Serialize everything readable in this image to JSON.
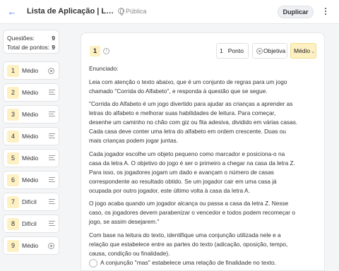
{
  "header": {
    "back_icon": "arrow-left-icon",
    "title": "Lista de Aplicação | Leitura e Interpretação",
    "visibility": "Pública",
    "duplicate_label": "Duplicar",
    "more_icon": "kebab-icon"
  },
  "sidebar": {
    "questions_label": "Questões:",
    "questions_count": "9",
    "points_label": "Total de pontos:",
    "points_count": "9",
    "items": [
      {
        "num": "1",
        "difficulty": "Médio",
        "type": "objective"
      },
      {
        "num": "2",
        "difficulty": "Médio",
        "type": "essay"
      },
      {
        "num": "3",
        "difficulty": "Médio",
        "type": "essay"
      },
      {
        "num": "4",
        "difficulty": "Médio",
        "type": "essay"
      },
      {
        "num": "5",
        "difficulty": "Médio",
        "type": "essay"
      },
      {
        "num": "6",
        "difficulty": "Médio",
        "type": "essay"
      },
      {
        "num": "7",
        "difficulty": "Difícil",
        "type": "essay"
      },
      {
        "num": "8",
        "difficulty": "Difícil",
        "type": "essay"
      },
      {
        "num": "9",
        "difficulty": "Médio",
        "type": "objective"
      }
    ]
  },
  "question": {
    "number": "1",
    "points_value": "1",
    "points_label": "Ponto",
    "type_label": "Objetiva",
    "difficulty": "Médio",
    "statement_label": "Enunciado:",
    "paragraphs": [
      "Leia com atenção o texto abaixo, que é um conjunto de regras para um jogo chamado \"Corrida do Alfabeto\", e responda à questão que se segue.",
      "\"Corrida do Alfabeto é um jogo divertido para ajudar as crianças a aprender as letras do alfabeto e melhorar suas habilidades de leitura. Para começar, desenhe um caminho no chão com giz ou fita adesiva, dividido em várias casas. Cada casa deve conter uma letra do alfabeto em ordem crescente. Duas ou mais crianças podem jogar juntas.",
      "Cada jogador escolhe um objeto pequeno como marcador e posiciona-o na casa da letra A. O objetivo do jogo é ser o primeiro a chegar na casa da letra Z. Para isso, os jogadores jogam um dado e avançam o número de casas correspondente ao resultado obtido. Se um jogador cair em uma casa já ocupada por outro jogador, este último volta à casa da letra A.",
      "O jogo acaba quando um jogador alcança ou passa a casa da letra Z. Nesse caso, os jogadores devem parabenizar o vencedor e todos podem recomeçar o jogo, se assim desejarem.\"",
      "Com base na leitura do texto, identifique uma conjunção utilizada nele e a relação que estabelece entre as partes do texto (adicação, oposição, tempo, causa, condição ou finalidade)."
    ],
    "options": [
      "A conjunção \"mas\" estabelece uma relação de finalidade no texto."
    ]
  },
  "colors": {
    "accent": "#4a6cf7",
    "badge": "#fdf0c2"
  }
}
